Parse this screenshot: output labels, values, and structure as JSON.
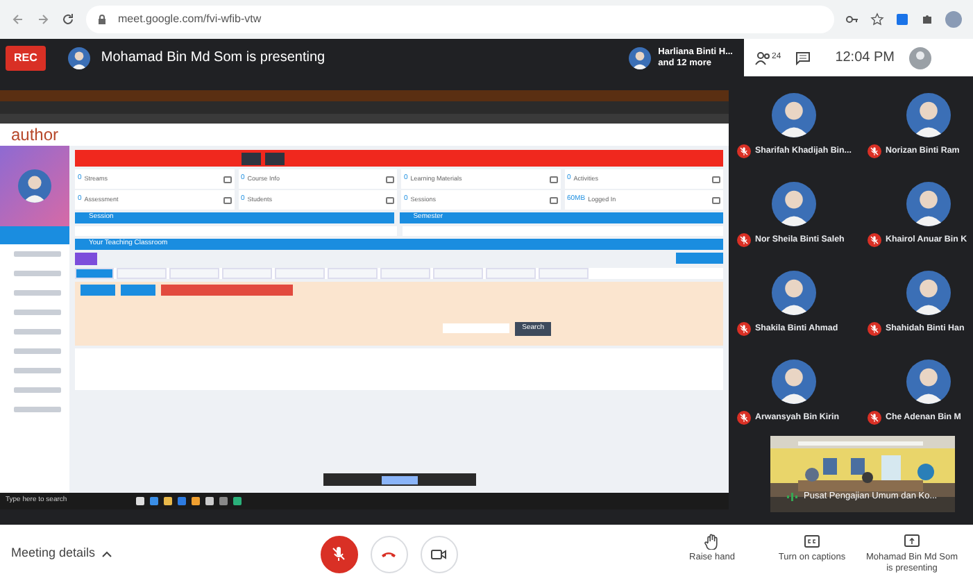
{
  "browser": {
    "url": "meet.google.com/fvi-wfib-vtw"
  },
  "top_bar": {
    "recording": "REC",
    "presenter_text": "Mohamad Bin Md Som is presenting",
    "participants_summary": {
      "name": "Harliana Binti H...",
      "more": "and 12 more"
    },
    "people_count": "24",
    "time": "12:04 PM"
  },
  "shared_screen": {
    "logo": "author",
    "stats": [
      {
        "value": "0",
        "label": "Streams"
      },
      {
        "value": "0",
        "label": "Course Info"
      },
      {
        "value": "0",
        "label": "Learning Materials"
      },
      {
        "value": "0",
        "label": "Activities"
      },
      {
        "value": "0",
        "label": "Assessment"
      },
      {
        "value": "0",
        "label": "Students"
      },
      {
        "value": "0",
        "label": "Sessions"
      },
      {
        "value": "60MB",
        "label": "Logged In"
      }
    ],
    "sidebar_items": [
      {
        "selected": true
      },
      {
        "selected": false
      },
      {
        "selected": false
      },
      {
        "selected": false
      },
      {
        "selected": false
      },
      {
        "selected": false
      },
      {
        "selected": false
      },
      {
        "selected": false
      },
      {
        "selected": false
      },
      {
        "selected": false
      }
    ],
    "tabs": [
      {
        "selected": true
      },
      {
        "selected": false
      },
      {
        "selected": false
      },
      {
        "selected": false
      },
      {
        "selected": false
      },
      {
        "selected": false
      },
      {
        "selected": false
      },
      {
        "selected": false
      },
      {
        "selected": false
      },
      {
        "selected": false
      }
    ],
    "session_label": "Session",
    "semester_label": "Semester",
    "classroom_label": "Your Teaching Classroom",
    "search_button": "Search",
    "taskbar_search": "Type here to search"
  },
  "participants": [
    {
      "name": "Sharifah Khadijah Bin...",
      "muted": true
    },
    {
      "name": "Norizan Binti Ram",
      "muted": true
    },
    {
      "name": "Nor Sheila Binti Saleh",
      "muted": true
    },
    {
      "name": "Khairol Anuar Bin K",
      "muted": true
    },
    {
      "name": "Shakila Binti Ahmad",
      "muted": true
    },
    {
      "name": "Shahidah Binti Han",
      "muted": true
    },
    {
      "name": "Arwansyah Bin Kirin",
      "muted": true
    },
    {
      "name": "Che Adenan Bin M",
      "muted": true
    }
  ],
  "self_view": {
    "caption": "Pusat Pengajian Umum dan Ko..."
  },
  "bottom_bar": {
    "meeting_details": "Meeting details",
    "mic_muted": true,
    "actions": [
      {
        "label": "Raise hand",
        "kind": "hand"
      },
      {
        "label": "Turn on captions",
        "kind": "captions"
      },
      {
        "label": "Mohamad Bin Md Som is presenting",
        "kind": "present"
      }
    ]
  }
}
